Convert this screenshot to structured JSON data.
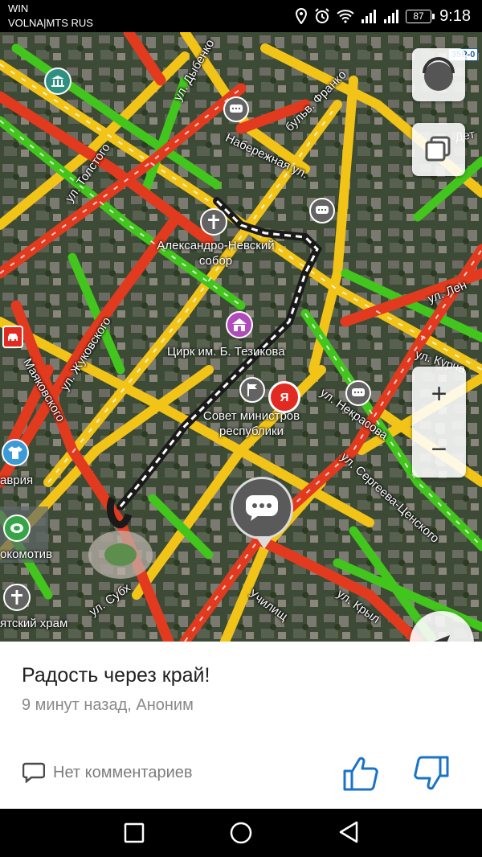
{
  "status_bar": {
    "carrier_line1": "WIN",
    "carrier_line2": "VOLNA|MTS RUS",
    "battery": "87",
    "time": "9:18",
    "icons": [
      "location-icon",
      "alarm-icon",
      "wifi-icon",
      "signal-icon",
      "signal-icon"
    ]
  },
  "map": {
    "road_badge": "35Р-0",
    "streets": {
      "tolstogo": "ул. Толстого",
      "dybenko": "ул. Дыбенко",
      "franko": "бульв. Франко",
      "naberezhnaya": "Набережная ул.",
      "zhukovskogo": "ул. Жуковского",
      "mayakovskogo": "Маяковского",
      "nekrasova": "ул. Некрасова",
      "sergeeva": "ул. Сергеева-Ценского",
      "lenina": "ул. Лен",
      "kurchatova": "ул. Курча",
      "subkh": "ул. Субх",
      "krylova": "ул. Крыл",
      "uchilishch": "Училищ",
      "det": "Дет"
    },
    "pois": {
      "cathedral": "Александро-Невский собор",
      "circus": "Цирк им. Б. Тезикова",
      "council": "Совет министров республики",
      "tavria": "аврия",
      "lokomotiv": "окомотив",
      "temple": "ятский храм"
    },
    "yandex_pin_letter": "Я",
    "zoom_in": "+",
    "zoom_out": "−",
    "colors": {
      "jam_red": "#e23a1e",
      "jam_yellow": "#f2c418",
      "free_green": "#42c51c"
    }
  },
  "card": {
    "title": "Радость через край!",
    "meta": "9 минут назад, Аноним",
    "comments_label": "Нет комментариев",
    "like_color": "#1a73c9"
  },
  "nav": {
    "icons": [
      "recent-apps-icon",
      "home-icon",
      "back-icon"
    ]
  }
}
